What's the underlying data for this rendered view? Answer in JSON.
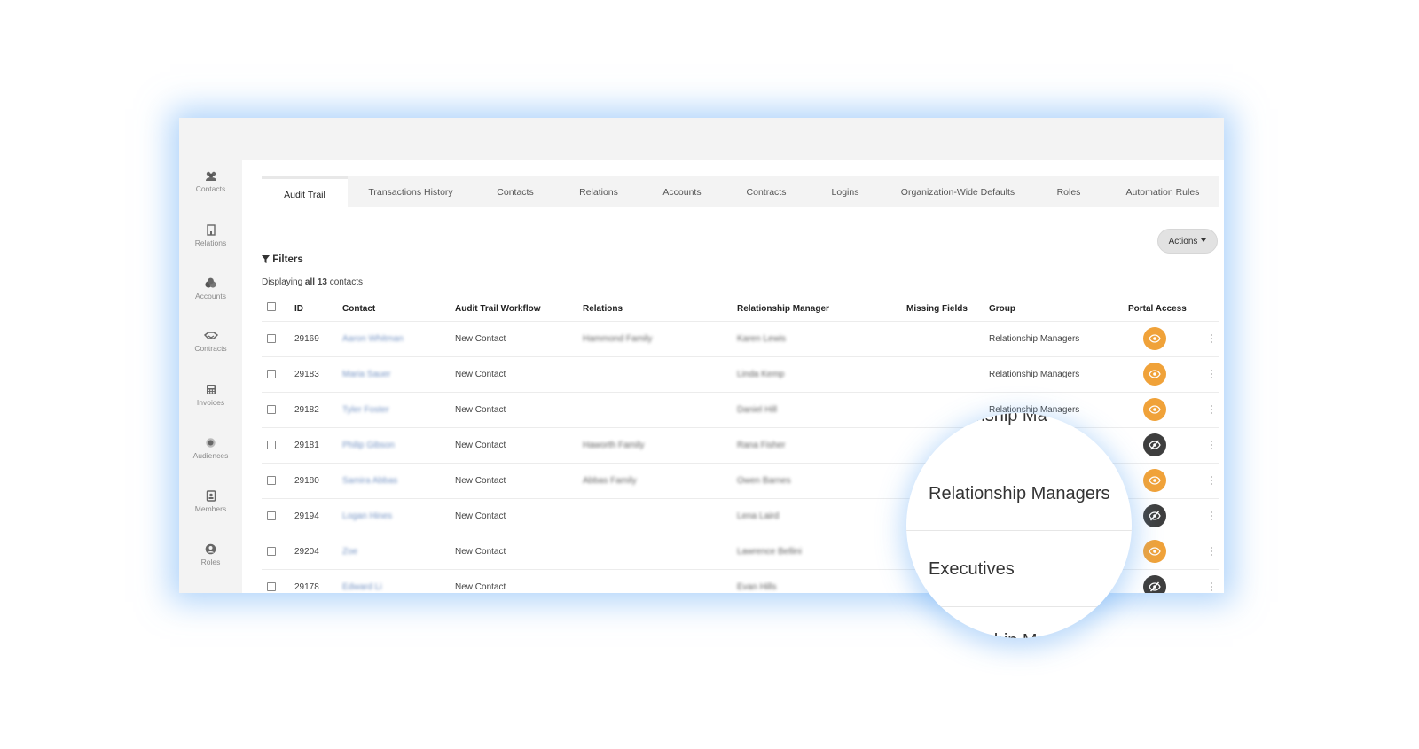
{
  "sidebar": {
    "items": [
      {
        "label": "Contacts",
        "icon": "users-icon"
      },
      {
        "label": "Relations",
        "icon": "building-icon"
      },
      {
        "label": "Accounts",
        "icon": "coins-icon"
      },
      {
        "label": "Contracts",
        "icon": "handshake-icon"
      },
      {
        "label": "Invoices",
        "icon": "calculator-icon"
      },
      {
        "label": "Audiences",
        "icon": "target-icon"
      },
      {
        "label": "Members",
        "icon": "id-badge-icon"
      },
      {
        "label": "Roles",
        "icon": "user-circle-icon"
      }
    ]
  },
  "tabs": [
    {
      "label": "Audit Trail",
      "active": true
    },
    {
      "label": "Transactions History"
    },
    {
      "label": "Contacts"
    },
    {
      "label": "Relations"
    },
    {
      "label": "Accounts"
    },
    {
      "label": "Contracts"
    },
    {
      "label": "Logins"
    },
    {
      "label": "Organization-Wide Defaults"
    },
    {
      "label": "Roles"
    },
    {
      "label": "Automation Rules"
    }
  ],
  "toolbar": {
    "actions_label": "Actions"
  },
  "filters": {
    "label": "Filters"
  },
  "display_count": {
    "prefix": "Displaying",
    "strong": "all 13",
    "suffix": "contacts"
  },
  "table": {
    "columns": [
      "ID",
      "Contact",
      "Audit Trail Workflow",
      "Relations",
      "Relationship Manager",
      "Missing Fields",
      "Group",
      "Portal Access"
    ],
    "rows": [
      {
        "id": "29169",
        "contact": "Aaron Whitman",
        "workflow": "New Contact",
        "relations": "Hammond Family",
        "manager": "Karen Lewis",
        "missing": "",
        "group": "Relationship Managers",
        "portal": "granted"
      },
      {
        "id": "29183",
        "contact": "Maria Sauer",
        "workflow": "New Contact",
        "relations": "",
        "manager": "Linda Kemp",
        "missing": "",
        "group": "Relationship Managers",
        "portal": "granted"
      },
      {
        "id": "29182",
        "contact": "Tyler Foster",
        "workflow": "New Contact",
        "relations": "",
        "manager": "Daniel Hill",
        "missing": "",
        "group": "Relationship Managers",
        "portal": "granted"
      },
      {
        "id": "29181",
        "contact": "Philip Gibson",
        "workflow": "New Contact",
        "relations": "Haworth Family",
        "manager": "Rana Fisher",
        "missing": "",
        "group": "",
        "portal": "denied"
      },
      {
        "id": "29180",
        "contact": "Samira Abbas",
        "workflow": "New Contact",
        "relations": "Abbas Family",
        "manager": "Owen Barnes",
        "missing": "",
        "group": "",
        "portal": "granted"
      },
      {
        "id": "29194",
        "contact": "Logan Hines",
        "workflow": "New Contact",
        "relations": "",
        "manager": "Lena Laird",
        "missing": "",
        "group": "",
        "portal": "denied"
      },
      {
        "id": "29204",
        "contact": "Zoe",
        "workflow": "New Contact",
        "relations": "",
        "manager": "Lawrence Bellini",
        "missing": "",
        "group": "",
        "portal": "granted"
      },
      {
        "id": "29178",
        "contact": "Edward Li",
        "workflow": "New Contact",
        "relations": "",
        "manager": "Evan Hills",
        "missing": "",
        "group": "",
        "portal": "denied"
      }
    ]
  },
  "magnifier": {
    "top_partial": "ionship Ma",
    "item1": "Relationship Managers",
    "item2": "Executives",
    "bottom_partial": "ionship Ma"
  },
  "colors": {
    "accent_orange": "#f0a239",
    "portal_denied": "#3e3e3e",
    "glow": "#6eaff5",
    "sidebar_bg": "#f3f3f3"
  }
}
